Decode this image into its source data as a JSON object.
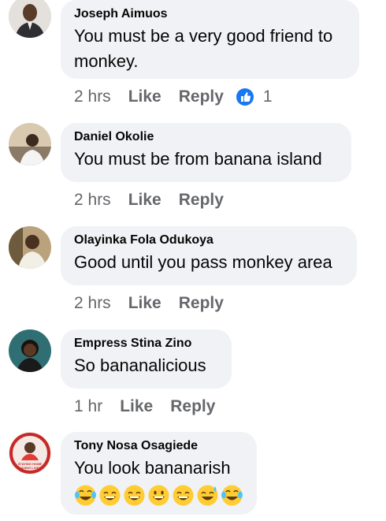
{
  "comments": [
    {
      "author": "Joseph Aimuos",
      "text_lines": [
        "You must be a very good friend to",
        "monkey."
      ],
      "time": "2 hrs",
      "like_label": "Like",
      "reply_label": "Reply",
      "reaction_count": "1"
    },
    {
      "author": "Daniel Okolie",
      "text_lines": [
        "You must be from banana island"
      ],
      "time": "2 hrs",
      "like_label": "Like",
      "reply_label": "Reply"
    },
    {
      "author": "Olayinka Fola Odukoya",
      "text_lines": [
        "Good until you pass monkey area"
      ],
      "time": "2 hrs",
      "like_label": "Like",
      "reply_label": "Reply"
    },
    {
      "author": "Empress Stina Zino",
      "text_lines": [
        "So bananalicious"
      ],
      "time": "1 hr",
      "like_label": "Like",
      "reply_label": "Reply"
    },
    {
      "author": "Tony Nosa Osagiede",
      "text_lines": [
        "You look bananarish"
      ],
      "emojis": [
        "tears-of-joy-icon",
        "grinning-smiling-eyes-icon",
        "grinning-smiling-eyes-icon",
        "grinning-face-icon",
        "grinning-smiling-eyes-icon",
        "grinning-sweat-icon",
        "tears-of-joy-icon"
      ],
      "avatar_text": [
        "STAYING HOME",
        "SAVING LIVES"
      ]
    }
  ],
  "colors": {
    "bubble": "#f0f2f5",
    "meta_text": "#65676b",
    "like_badge": "#1877f2",
    "emoji_yellow": "#ffcc33"
  }
}
